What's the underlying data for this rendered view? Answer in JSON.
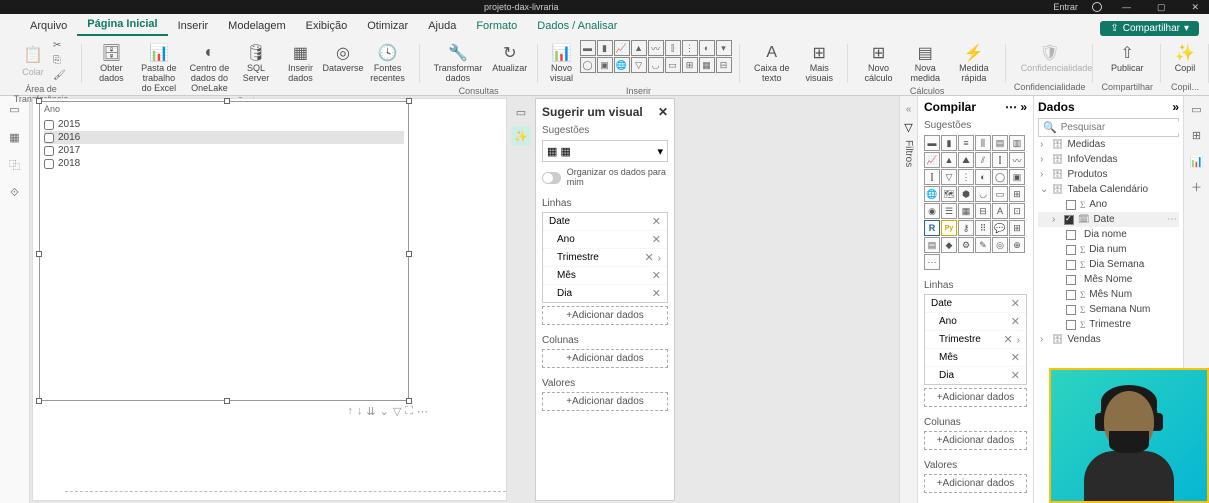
{
  "titlebar": {
    "project": "projeto-dax-livraria",
    "user": "Entrar",
    "min": "—",
    "max": "▢",
    "close": "✕"
  },
  "tabs": {
    "arquivo": "Arquivo",
    "pagina": "Página Inicial",
    "inserir": "Inserir",
    "modelagem": "Modelagem",
    "exibicao": "Exibição",
    "otimizar": "Otimizar",
    "ajuda": "Ajuda",
    "formato": "Formato",
    "dados": "Dados / Analisar",
    "share": "Compartilhar"
  },
  "ribbon": {
    "colar": "Colar",
    "obter": "Obter dados",
    "excel": "Pasta de trabalho do Excel",
    "onelake": "Centro de dados do OneLake",
    "sql": "SQL Server",
    "inserir_dados": "Inserir dados",
    "dataverse": "Dataverse",
    "fontes": "Fontes recentes",
    "transformar": "Transformar dados",
    "atualizar": "Atualizar",
    "novo_visual": "Novo visual",
    "caixa_texto": "Caixa de texto",
    "mais_visuais": "Mais visuais",
    "novo_calculo": "Novo cálculo",
    "nova_medida": "Nova medida",
    "medida_rapida": "Medida rápida",
    "confid": "Confidencialidade",
    "publicar": "Publicar",
    "copilot": "Copil",
    "g_clip": "Área de Transferência",
    "g_dados": "Dados",
    "g_consultas": "Consultas",
    "g_inserir": "Inserir",
    "g_calculos": "Cálculos",
    "g_confid": "Confidencialidade",
    "g_share": "Compartilhar",
    "g_copil": "Copil..."
  },
  "canvas": {
    "header": "Ano",
    "years": [
      "2015",
      "2016",
      "2017",
      "2018"
    ]
  },
  "suggest": {
    "title": "Sugerir um visual",
    "sub": "Sugestões",
    "toggle": "Organizar os dados para mim",
    "linhas": "Linhas",
    "colunas": "Colunas",
    "valores": "Valores",
    "fields": {
      "date": "Date",
      "ano": "Ano",
      "trimestre": "Trimestre",
      "mes": "Mês",
      "dia": "Dia"
    },
    "add": "+Adicionar dados"
  },
  "filters": "Filtros",
  "compile": {
    "title": "Compilar",
    "sub": "Sugestões",
    "linhas": "Linhas",
    "colunas": "Colunas",
    "valores": "Valores",
    "fields": {
      "date": "Date",
      "ano": "Ano",
      "trimestre": "Trimestre",
      "mes": "Mês",
      "dia": "Dia"
    },
    "add": "+Adicionar dados"
  },
  "data": {
    "title": "Dados",
    "search": "Pesquisar",
    "tables": {
      "medidas": "Medidas",
      "infovendas": "InfoVendas",
      "produtos": "Produtos",
      "calendario": "Tabela Calendário",
      "vendas": "Vendas"
    },
    "cols": {
      "ano": "Ano",
      "date": "Date",
      "dianome": "Dia nome",
      "dianum": "Dia num",
      "diasemana": "Dia Semana",
      "mesnome": "Mês Nome",
      "mesnum": "Mês Num",
      "semananum": "Semana Num",
      "trimestre": "Trimestre"
    }
  },
  "chart_data": {
    "type": "table",
    "title": "Ano",
    "categories": [
      "Ano"
    ],
    "values": [
      2015,
      2016,
      2017,
      2018
    ]
  }
}
